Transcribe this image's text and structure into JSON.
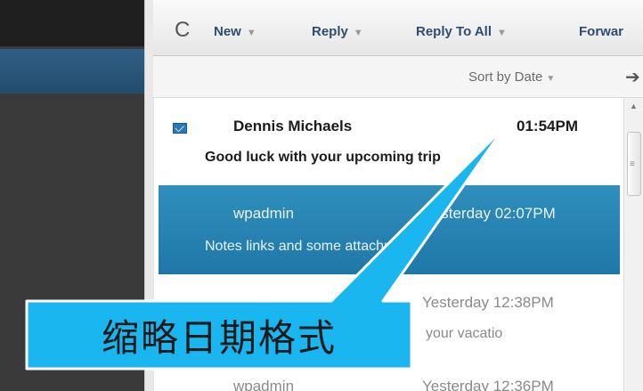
{
  "toolbar": {
    "refresh_icon": "refresh-icon",
    "buttons": [
      {
        "label": "New",
        "has_caret": true
      },
      {
        "label": "Reply",
        "has_caret": true
      },
      {
        "label": "Reply To All",
        "has_caret": true
      },
      {
        "label": "Forwar",
        "has_caret": false
      }
    ],
    "caret_glyph": "▼"
  },
  "sort": {
    "label": "Sort by Date",
    "caret_glyph": "▼",
    "arrow_icon": "arrow-right-icon"
  },
  "messages": [
    {
      "sender": "Dennis Michaels",
      "time": "01:54PM",
      "subject": "Good luck with your upcoming trip",
      "unread": true,
      "selected": false
    },
    {
      "sender": "wpadmin",
      "time": "Yesterday 02:07PM",
      "subject": "Notes links and some attachm",
      "attachment_icon": "paperclip-icon",
      "unread": false,
      "selected": true
    },
    {
      "sender": "",
      "time": "Yesterday 12:38PM",
      "subject": "your vacatio",
      "unread": false,
      "selected": false
    },
    {
      "sender": "wpadmin",
      "time": "Yesterday 12:36PM",
      "subject": "",
      "unread": false,
      "selected": false
    }
  ],
  "callout": {
    "text": "缩略日期格式",
    "fill_color": "#19b6f0",
    "border_color": "#ffffff"
  },
  "colors": {
    "selected_row": "#2a88b8",
    "toolbar_text": "#2e4d6e",
    "left_panel": "#3a3a3a",
    "left_nav": "#2a5679"
  }
}
